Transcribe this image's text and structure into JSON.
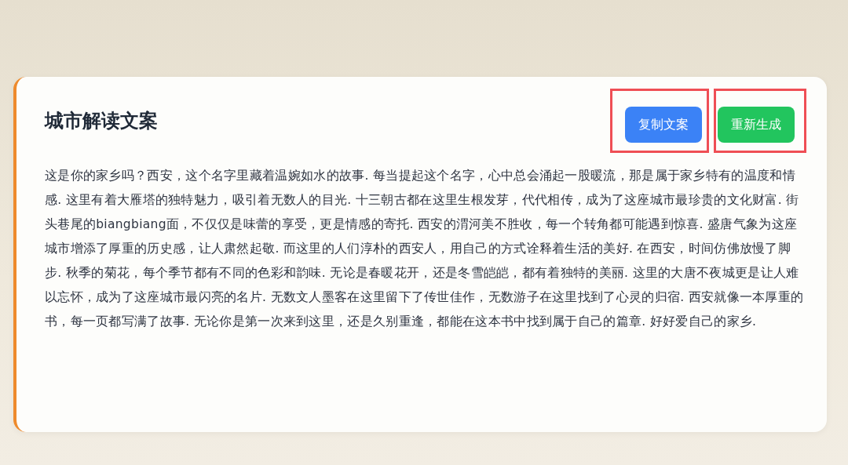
{
  "card": {
    "title": "城市解读文案",
    "buttons": [
      {
        "label": "复制文案",
        "kind": "copy",
        "highlighted": true
      },
      {
        "label": "重新生成",
        "kind": "regenerate",
        "highlighted": true
      }
    ],
    "text": "这是你的家乡吗？西安，这个名字里藏着温婉如水的故事. 每当提起这个名字，心中总会涌起一股暖流，那是属于家乡特有的温度和情感. 这里有着大雁塔的独特魅力，吸引着无数人的目光. 十三朝古都在这里生根发芽，代代相传，成为了这座城市最珍贵的文化财富. 街头巷尾的biangbiang面，不仅仅是味蕾的享受，更是情感的寄托. 西安的渭河美不胜收，每一个转角都可能遇到惊喜. 盛唐气象为这座城市增添了厚重的历史感，让人肃然起敬. 而这里的人们淳朴的西安人，用自己的方式诠释着生活的美好. 在西安，时间仿佛放慢了脚步. 秋季的菊花，每个季节都有不同的色彩和韵味. 无论是春暖花开，还是冬雪皑皑，都有着独特的美丽. 这里的大唐不夜城更是让人难以忘怀，成为了这座城市最闪亮的名片. 无数文人墨客在这里留下了传世佳作，无数游子在这里找到了心灵的归宿. 西安就像一本厚重的书，每一页都写满了故事. 无论你是第一次来到这里，还是久别重逢，都能在这本书中找到属于自己的篇章. 好好爱自己的家乡."
  }
}
